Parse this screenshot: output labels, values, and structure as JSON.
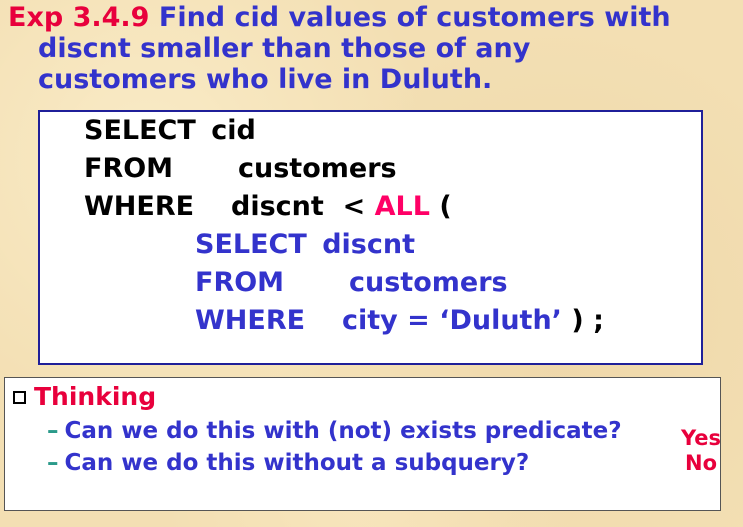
{
  "title": {
    "number": "Exp 3.4.9",
    "line1_rest": " Find cid values of customers with",
    "line2": "discnt smaller than those of any",
    "line3": "customers who live in Duluth."
  },
  "sql": {
    "select_kw": "SELECT",
    "select_col": "cid",
    "from_kw": "FROM",
    "from_tbl": "customers",
    "where_kw": "WHERE",
    "where_expr": "discnt  < ",
    "all_kw": "ALL",
    "paren_open": " (",
    "sub_select_kw": "SELECT",
    "sub_select_col": "discnt",
    "sub_from_kw": "FROM",
    "sub_from_tbl": "customers",
    "sub_where_kw": "WHERE",
    "sub_where_expr": "city = ‘Duluth’",
    "close": " ) ;"
  },
  "thinking": {
    "heading": "Thinking",
    "questions": [
      {
        "dash": "–",
        "text": "Can we do this with (not) exists predicate?",
        "answer": "Yes"
      },
      {
        "dash": "–",
        "text": "Can we do this without a subquery?",
        "answer": "No"
      }
    ]
  },
  "colors": {
    "background": "#f3dfb3",
    "title_blue": "#3333cc",
    "accent_red": "#e8003c",
    "all_pink": "#ff0066",
    "box_border": "#1f1f99"
  }
}
